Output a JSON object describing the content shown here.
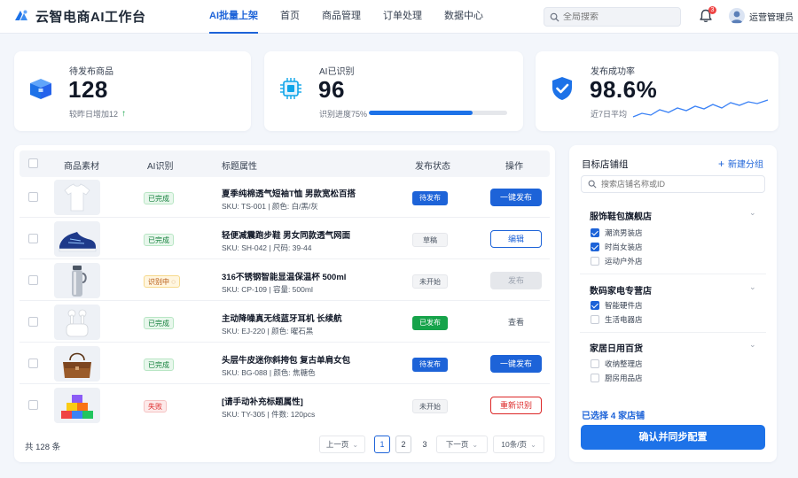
{
  "app": {
    "title": "云智电商AI工作台"
  },
  "nav": {
    "items": [
      "AI批量上架",
      "首页",
      "商品管理",
      "订单处理",
      "数据中心"
    ],
    "active": 0
  },
  "header": {
    "search_placeholder": "全局搜索",
    "notification_count": "3",
    "user_name": "运营管理员"
  },
  "stats": {
    "pending": {
      "label": "待发布商品",
      "value": "128",
      "sub": "较昨日增加12"
    },
    "recognized": {
      "label": "AI已识别",
      "value": "96",
      "sub": "识别进度75%",
      "progress": 0.75
    },
    "success": {
      "label": "发布成功率",
      "value": "98.6%",
      "sub": "近7日平均"
    }
  },
  "table": {
    "headers": [
      "商品素材",
      "AI识别",
      "标题属性",
      "发布状态",
      "操作"
    ],
    "rows": [
      {
        "ai": "已完成",
        "ai_type": "done",
        "title": "夏季纯棉透气短袖T恤 男款宽松百搭",
        "sub": "SKU: TS-001 | 颜色: 白/黑/灰",
        "status": "待发布",
        "status_type": "wait",
        "action": "一键发布",
        "action_type": "primary",
        "image": "tshirt"
      },
      {
        "ai": "已完成",
        "ai_type": "done",
        "title": "轻便减震跑步鞋 男女同款透气网面",
        "sub": "SKU: SH-042 | 尺码: 39-44",
        "status": "草稿",
        "status_type": "draft",
        "action": "编辑",
        "action_type": "outline",
        "image": "shoe"
      },
      {
        "ai": "识别中",
        "ai_type": "busy",
        "title": "316不锈钢智能显温保温杯 500ml",
        "sub": "SKU: CP-109 | 容量: 500ml",
        "status": "未开始",
        "status_type": "draft",
        "action": "发布",
        "action_type": "disabled",
        "image": "bottle"
      },
      {
        "ai": "已完成",
        "ai_type": "done",
        "title": "主动降噪真无线蓝牙耳机 长续航",
        "sub": "SKU: EJ-220 | 颜色: 曜石黑",
        "status": "已发布",
        "status_type": "pub",
        "action": "查看",
        "action_type": "text",
        "image": "earbuds"
      },
      {
        "ai": "已完成",
        "ai_type": "done",
        "title": "头层牛皮迷你斜挎包 复古单肩女包",
        "sub": "SKU: BG-088 | 颜色: 焦糖色",
        "status": "待发布",
        "status_type": "wait",
        "action": "一键发布",
        "action_type": "primary",
        "image": "bag"
      },
      {
        "ai": "失败",
        "ai_type": "fail",
        "title": "[请手动补充标题属性]",
        "sub": "SKU: TY-305 | 件数: 120pcs",
        "status": "未开始",
        "status_type": "draft",
        "action": "重新识别",
        "action_type": "danger",
        "image": "blocks"
      }
    ],
    "total": "共 128 条",
    "pagination": {
      "prev": "上一页",
      "pages": [
        "1",
        "2",
        "3"
      ],
      "current": "1",
      "next": "下一页",
      "page_size": "10条/页"
    }
  },
  "shops": {
    "title": "目标店铺组",
    "new_group": "新建分组",
    "search_placeholder": "搜索店铺名称或ID",
    "groups": [
      {
        "name": "服饰鞋包旗舰店",
        "shops": [
          {
            "name": "潮流男装店",
            "checked": true
          },
          {
            "name": "时尚女装店",
            "checked": true
          },
          {
            "name": "运动户外店",
            "checked": false
          }
        ]
      },
      {
        "name": "数码家电专营店",
        "shops": [
          {
            "name": "智能硬件店",
            "checked": true
          },
          {
            "name": "生活电器店",
            "checked": false
          }
        ]
      },
      {
        "name": "家居日用百货",
        "shops": [
          {
            "name": "收纳整理店",
            "checked": false
          },
          {
            "name": "厨房用品店",
            "checked": false
          }
        ]
      }
    ],
    "selected_text": "已选择 4 家店铺",
    "confirm": "确认并同步配置"
  },
  "colors": {
    "primary": "#1d63d8",
    "success": "#16a34a",
    "danger": "#dc2626",
    "warning": "#b45309"
  }
}
